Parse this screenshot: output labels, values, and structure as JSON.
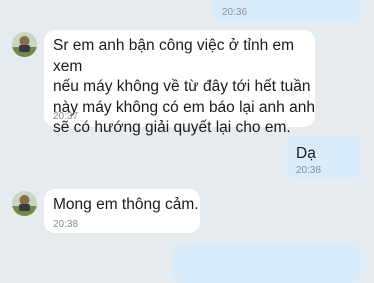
{
  "chat": {
    "messages": [
      {
        "direction": "out",
        "text": "",
        "time": "20:36"
      },
      {
        "direction": "in",
        "text": "Sr em anh bận công việc ở tỉnh em xem\nnếu máy không về từ đây tới hết tuần\nnày máy không có em báo lại anh anh\nsẽ có hướng giải quyết lại cho em.",
        "time": "20:37"
      },
      {
        "direction": "out",
        "text": "Dạ",
        "time": "20:38"
      },
      {
        "direction": "in",
        "text": "Mong em thông cảm.",
        "time": "20:38"
      },
      {
        "direction": "out",
        "text": "",
        "time": ""
      }
    ]
  },
  "colors": {
    "background": "#e6ebf0",
    "incoming_bubble": "#ffffff",
    "outgoing_bubble": "#d9ecfb",
    "timestamp": "#8a8f94"
  },
  "icons": {
    "contact_avatar": "avatar-icon"
  }
}
